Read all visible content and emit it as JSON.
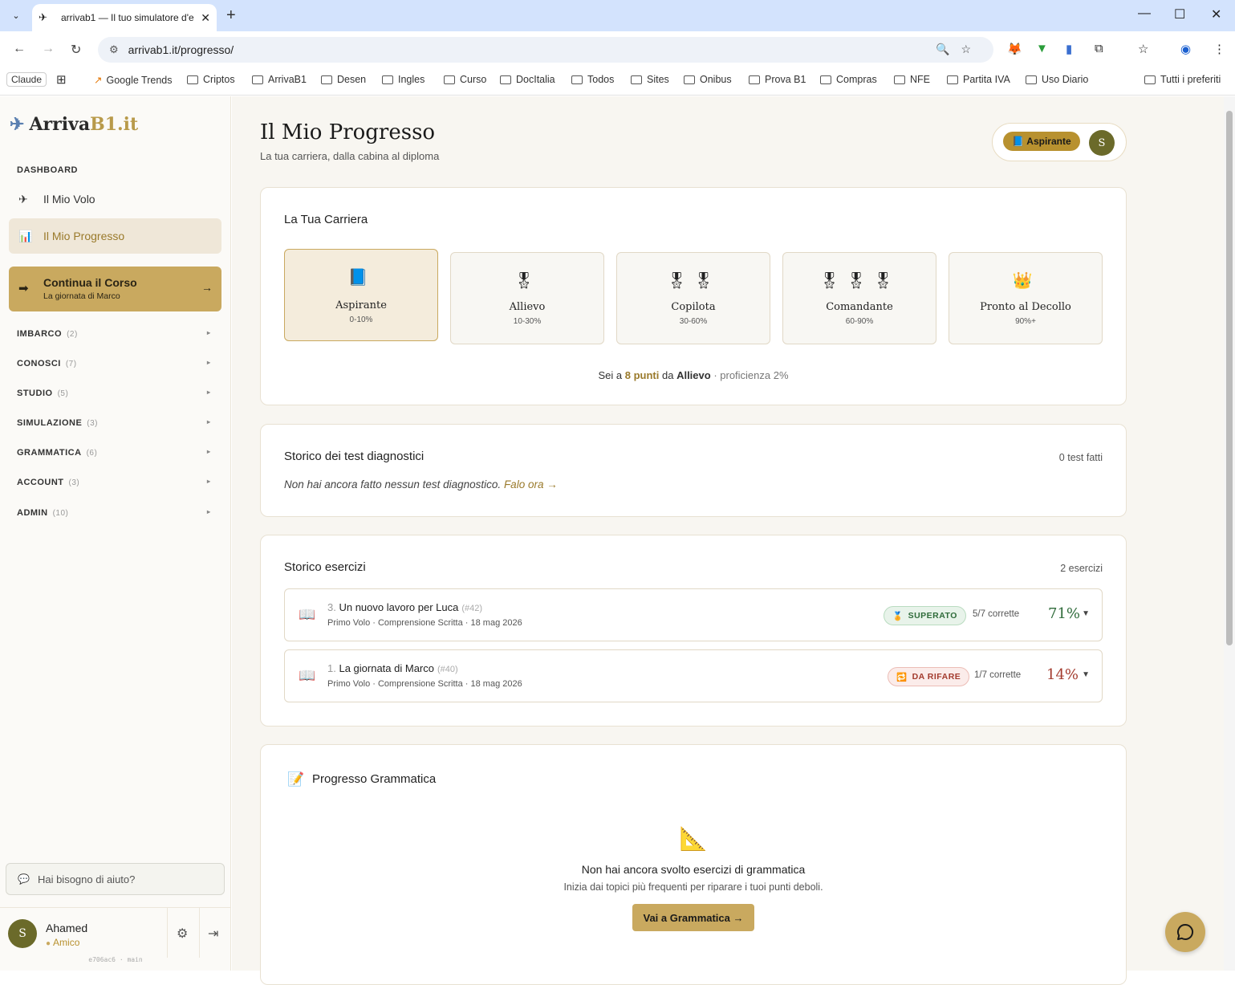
{
  "browser": {
    "tab_title": "arrivab1 — Il tuo simulatore d'e",
    "url": "arrivab1.it/progresso/",
    "bookmarks": [
      "Claude",
      "Google Trends",
      "Criptos",
      "ArrivaB1",
      "Desen",
      "Ingles",
      "Curso",
      "DocItalia",
      "Todos",
      "Sites",
      "Onibus",
      "Prova B1",
      "Compras",
      "NFE",
      "Partita IVA",
      "Uso Diario",
      "Tutti i preferiti"
    ]
  },
  "sidebar": {
    "logo_main": "Arriva",
    "logo_accent": "B1.it",
    "dashboard_label": "DASHBOARD",
    "nav": [
      {
        "label": "Il Mio Volo",
        "icon": "plane-icon"
      },
      {
        "label": "Il Mio Progresso",
        "icon": "chart-icon"
      }
    ],
    "cta": {
      "title": "Continua il Corso",
      "subtitle": "La giornata di Marco",
      "arrow": "→"
    },
    "sections": [
      {
        "label": "IMBARCO",
        "count": "(2)"
      },
      {
        "label": "CONOSCI",
        "count": "(7)"
      },
      {
        "label": "STUDIO",
        "count": "(5)"
      },
      {
        "label": "SIMULAZIONE",
        "count": "(3)"
      },
      {
        "label": "GRAMMATICA",
        "count": "(6)"
      },
      {
        "label": "ACCOUNT",
        "count": "(3)"
      },
      {
        "label": "ADMIN",
        "count": "(10)"
      }
    ],
    "help_placeholder": "Hai bisogno di aiuto?",
    "user": {
      "initial": "S",
      "name": "Ahamed",
      "role": "Amico"
    },
    "version": "e706ac6 · main"
  },
  "page": {
    "title": "Il Mio Progresso",
    "subtitle": "La tua carriera, dalla cabina al diploma",
    "rank_badge": "Aspirante",
    "avatar_initial": "S"
  },
  "career": {
    "title": "La Tua Carriera",
    "ranks": [
      {
        "name": "Aspirante",
        "range": "0-10%",
        "emoji": "📘",
        "active": true
      },
      {
        "name": "Allievo",
        "range": "10-30%",
        "emoji": "🎖",
        "active": false
      },
      {
        "name": "Copilota",
        "range": "30-60%",
        "emoji": "🎖🎖",
        "active": false
      },
      {
        "name": "Comandante",
        "range": "60-90%",
        "emoji": "🎖🎖🎖",
        "active": false
      },
      {
        "name": "Pronto al Decollo",
        "range": "90%+",
        "emoji": "👑",
        "active": false
      }
    ],
    "progress_prefix": "Sei a",
    "points": "8 punti",
    "progress_mid": "da",
    "next_rank": "Allievo",
    "proficiency": "· proficienza 2%"
  },
  "diagnostics": {
    "title": "Storico dei test diagnostici",
    "count": "0 test fatti",
    "empty_text": "Non hai ancora fatto nessun test diagnostico.",
    "empty_link": "Falo ora →"
  },
  "exercises": {
    "title": "Storico esercizi",
    "count": "2 esercizi",
    "items": [
      {
        "num": "3.",
        "title": "Un nuovo lavoro per Luca",
        "id": "(#42)",
        "meta": "Primo Volo · Comprensione Scritta · 18 mag 2026",
        "status": "SUPERATO",
        "status_icon": "🏅",
        "correct": "5/7 corrette",
        "pct": "71%",
        "passed": true
      },
      {
        "num": "1.",
        "title": "La giornata di Marco",
        "id": "(#40)",
        "meta": "Primo Volo · Comprensione Scritta · 18 mag 2026",
        "status": "DA RIFARE",
        "status_icon": "🔁",
        "correct": "1/7 corrette",
        "pct": "14%",
        "passed": false
      }
    ]
  },
  "grammar": {
    "title": "Progresso Grammatica",
    "empty_title": "Non hai ancora svolto esercizi di grammatica",
    "empty_sub": "Inizia dai topici più frequenti per riparare i tuoi punti deboli.",
    "button": "Vai a Grammatica →"
  }
}
